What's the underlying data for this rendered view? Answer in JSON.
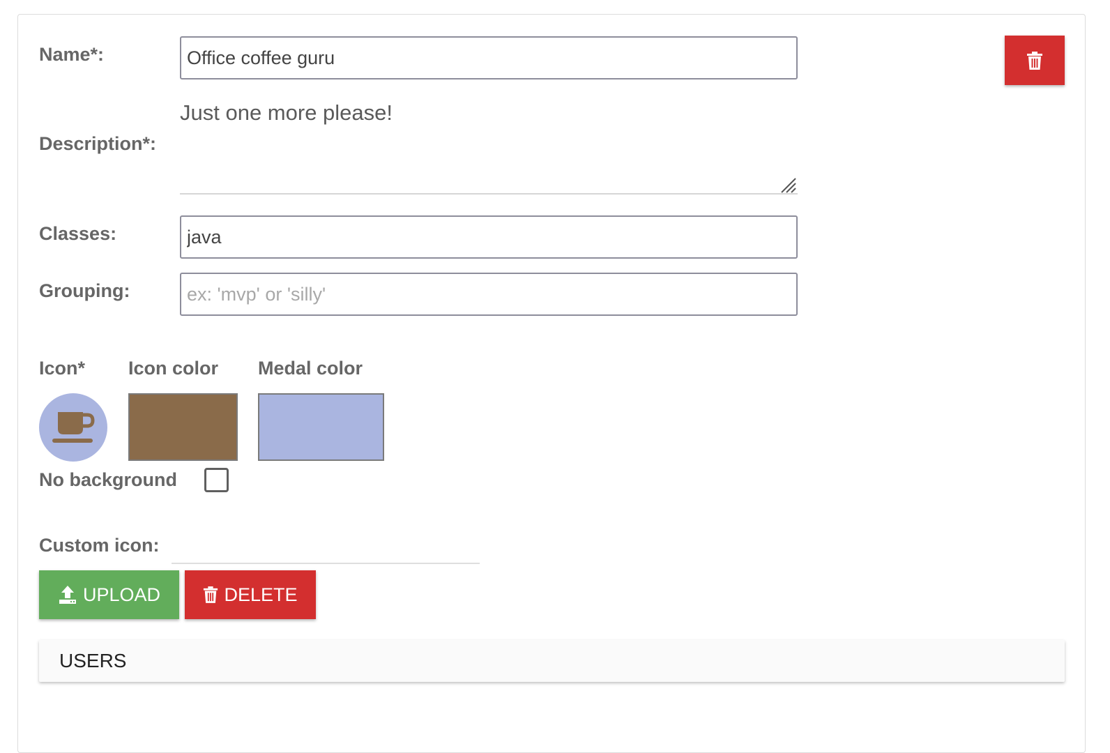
{
  "form": {
    "name_label": "Name*:",
    "name_value": "Office coffee guru",
    "description_label": "Description*:",
    "description_value": "Just one more please!",
    "classes_label": "Classes:",
    "classes_value": "java",
    "grouping_label": "Grouping:",
    "grouping_placeholder": "ex: 'mvp' or 'silly'",
    "grouping_value": ""
  },
  "appearance": {
    "icon_label": "Icon*",
    "icon_color_label": "Icon color",
    "medal_color_label": "Medal color",
    "icon_name": "coffee-cup-icon",
    "icon_color": "#8a6b4a",
    "medal_color": "#aab5e0",
    "no_background_label": "No background",
    "no_background_checked": false
  },
  "custom_icon": {
    "label": "Custom icon:",
    "upload_label": "UPLOAD",
    "delete_label": "DELETE"
  },
  "users_section": {
    "label": "USERS"
  },
  "colors": {
    "danger": "#d32f2f",
    "success": "#62ad5b"
  }
}
